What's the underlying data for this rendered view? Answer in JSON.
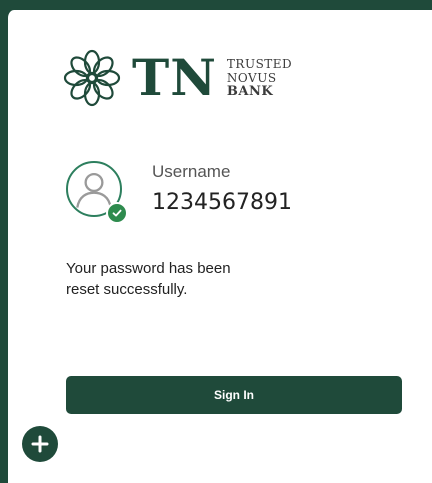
{
  "brand": {
    "logo_icon": "flower-logo-icon",
    "mark": "TN",
    "name_line1": "TRUSTED",
    "name_line2": "NOVUS",
    "name_line3": "BANK",
    "color": "#1f4a3a"
  },
  "user": {
    "label": "Username",
    "value": "1234567891",
    "avatar_icon": "user-avatar-icon",
    "status_icon": "check-circle-icon",
    "status_color": "#2e8b4e"
  },
  "message": {
    "text": "Your password has been reset successfully."
  },
  "actions": {
    "sign_in_label": "Sign In",
    "fab_icon": "plus-circle-icon"
  }
}
